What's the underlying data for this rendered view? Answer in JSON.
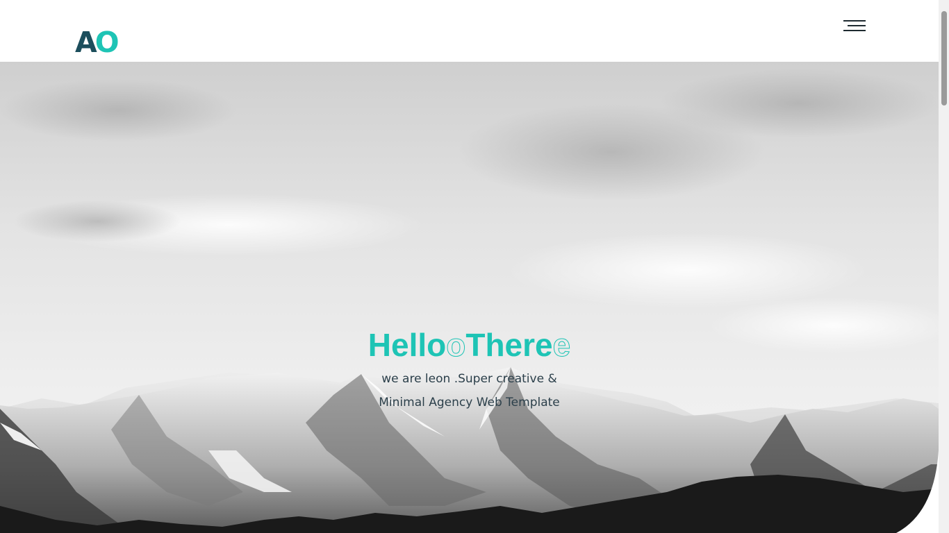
{
  "loader": {
    "progress": 0.2
  },
  "header": {
    "logo": {
      "part1": "A",
      "part2": "O"
    },
    "menu_icon": "hamburger-menu-icon"
  },
  "hero": {
    "background": "black-and-white snowy mountain range under cloudy sky",
    "title_part1": "Hello",
    "title_part2": "o",
    "title_part3": "There",
    "title_part4": "e",
    "subtitle_line1": "we are leon .Super creative &",
    "subtitle_line2": "Minimal Agency Web Template"
  },
  "colors": {
    "accent": "#1ec4b5",
    "logo_dark": "#1c4e5c",
    "text_dark": "#2b3f4a",
    "loader": "#1c5a6e"
  }
}
